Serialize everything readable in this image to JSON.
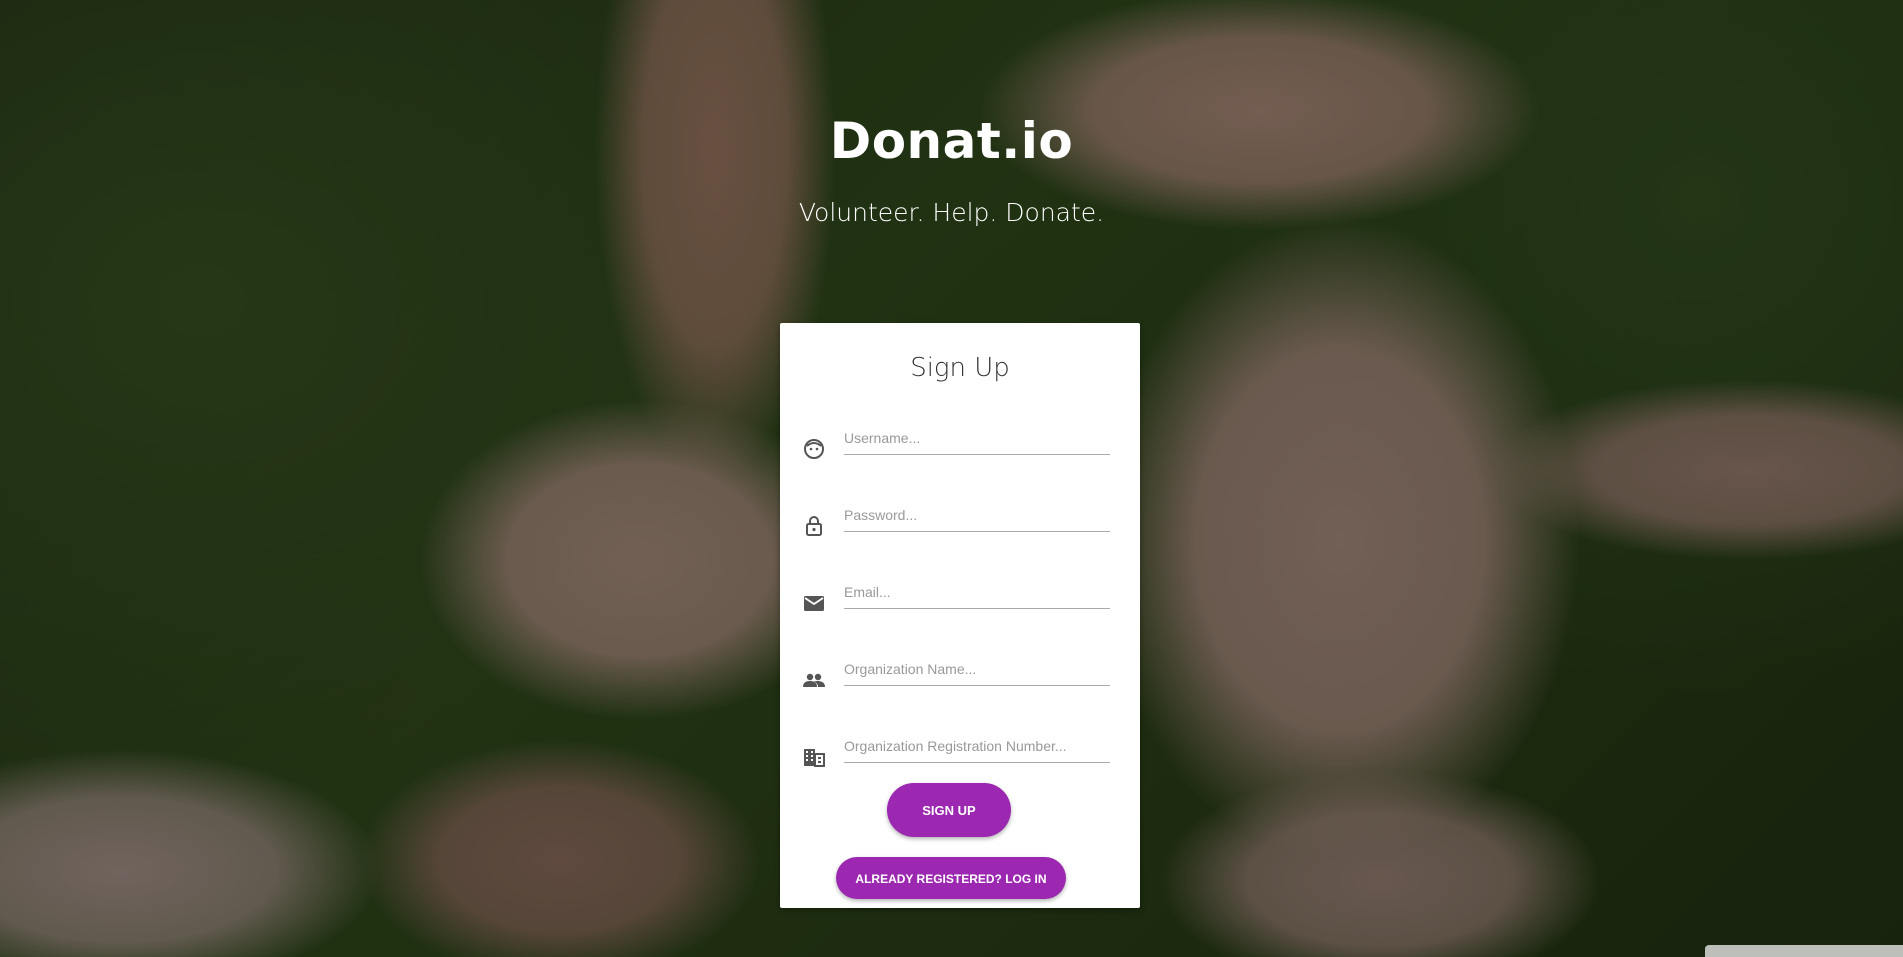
{
  "header": {
    "brand": "Donat.io",
    "tagline": "Volunteer. Help. Donate."
  },
  "form": {
    "title": "Sign Up",
    "fields": [
      {
        "icon": "face-icon",
        "placeholder": "Username...",
        "value": ""
      },
      {
        "icon": "lock-icon",
        "placeholder": "Password...",
        "value": ""
      },
      {
        "icon": "mail-icon",
        "placeholder": "Email...",
        "value": ""
      },
      {
        "icon": "people-icon",
        "placeholder": "Organization Name...",
        "value": ""
      },
      {
        "icon": "business-icon",
        "placeholder": "Organization Registration Number...",
        "value": ""
      }
    ],
    "signup_label": "SIGN UP",
    "login_label": "ALREADY REGISTERED? LOG IN"
  },
  "colors": {
    "accent": "#9c27b0",
    "card": "#ffffff",
    "icon": "#555555"
  }
}
